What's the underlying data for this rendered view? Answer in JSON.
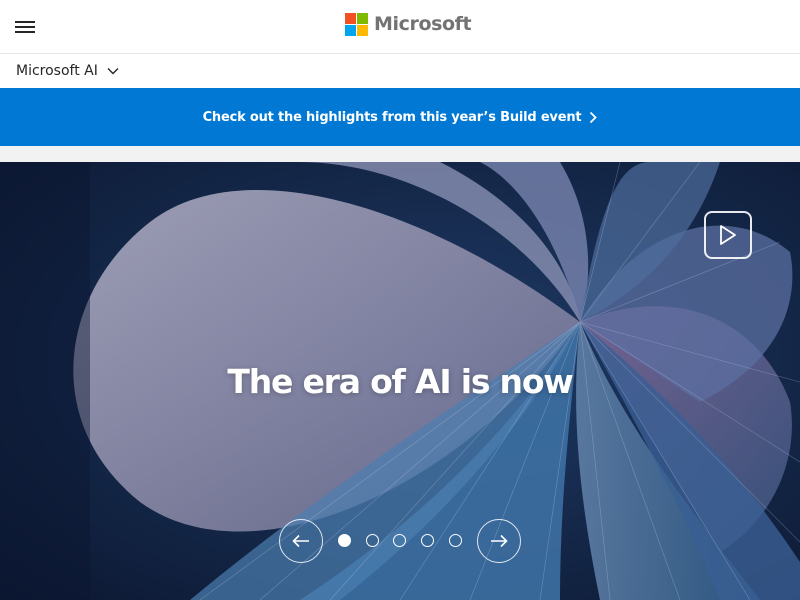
{
  "header": {
    "menu_icon": "hamburger-menu-icon",
    "brand_name": "Microsoft",
    "logo_colors": [
      "#f25022",
      "#7fba00",
      "#00a4ef",
      "#ffb900"
    ]
  },
  "subnav": {
    "title": "Microsoft AI",
    "icon": "chevron-down-icon"
  },
  "banner": {
    "text": "Check out the highlights from this year’s Build event",
    "icon": "chevron-right-icon",
    "background": "#0078d4"
  },
  "hero": {
    "headline": "The era of AI is now",
    "play_icon": "play-icon",
    "carousel": {
      "prev_icon": "arrow-left-icon",
      "next_icon": "arrow-right-icon",
      "slide_count": 5,
      "active_index": 1
    }
  }
}
